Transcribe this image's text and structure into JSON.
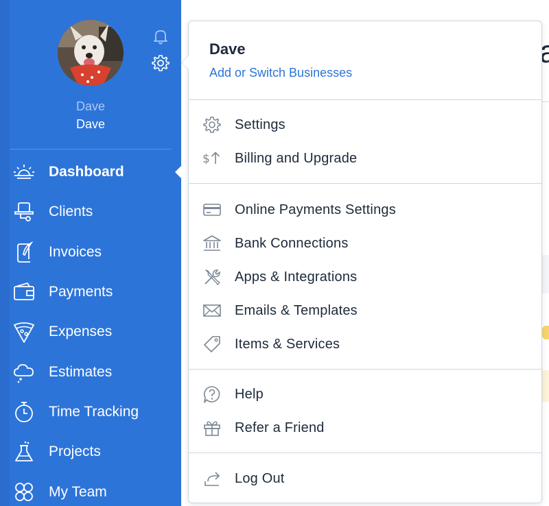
{
  "colors": {
    "sidebar": "#2d74d9",
    "accent": "#2d74d9",
    "text_dark": "#1d2a3a",
    "icon_gray": "#7b8794"
  },
  "sidebar": {
    "user": {
      "name_line_1": "Dave",
      "name_line_2": "Dave"
    },
    "icons": [
      "bell-icon",
      "gear-icon"
    ],
    "nav": [
      {
        "label": "Dashboard",
        "icon": "sunrise-icon",
        "active": true
      },
      {
        "label": "Clients",
        "icon": "hat-icon",
        "active": false
      },
      {
        "label": "Invoices",
        "icon": "quill-scroll-icon",
        "active": false
      },
      {
        "label": "Payments",
        "icon": "wallet-icon",
        "active": false
      },
      {
        "label": "Expenses",
        "icon": "pizza-icon",
        "active": false
      },
      {
        "label": "Estimates",
        "icon": "cloud-icon",
        "active": false
      },
      {
        "label": "Time Tracking",
        "icon": "stopwatch-icon",
        "active": false
      },
      {
        "label": "Projects",
        "icon": "flask-icon",
        "active": false
      },
      {
        "label": "My Team",
        "icon": "team-icon",
        "active": false
      }
    ]
  },
  "dropdown": {
    "header": {
      "name": "Dave",
      "switch_label": "Add or Switch Businesses"
    },
    "groups": [
      [
        {
          "label": "Settings",
          "icon": "gear-icon"
        },
        {
          "label": "Billing and Upgrade",
          "icon": "dollar-upgrade-icon"
        }
      ],
      [
        {
          "label": "Online Payments Settings",
          "icon": "credit-card-icon"
        },
        {
          "label": "Bank Connections",
          "icon": "bank-icon"
        },
        {
          "label": "Apps & Integrations",
          "icon": "tools-icon"
        },
        {
          "label": "Emails & Templates",
          "icon": "envelope-icon"
        },
        {
          "label": "Items & Services",
          "icon": "tag-icon"
        }
      ],
      [
        {
          "label": "Help",
          "icon": "help-bubble-icon"
        },
        {
          "label": "Refer a Friend",
          "icon": "gift-icon"
        }
      ],
      [
        {
          "label": "Log Out",
          "icon": "logout-arrow-icon"
        }
      ]
    ]
  },
  "background": {
    "partial_heading": "a"
  }
}
